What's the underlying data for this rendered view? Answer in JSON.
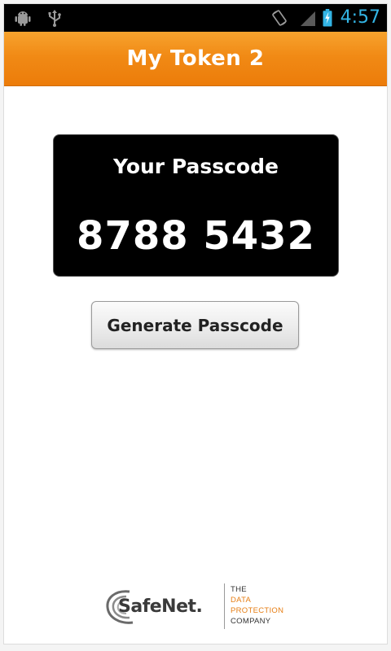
{
  "status_bar": {
    "time": "4:57",
    "icons": [
      "android-debug-icon",
      "usb-icon",
      "screen-rotation-icon",
      "signal-icon",
      "battery-charging-icon"
    ],
    "time_color": "#33b5e5"
  },
  "header": {
    "title": "My Token 2",
    "color": "#f18a15"
  },
  "passcode": {
    "label": "Your Passcode",
    "value": "8788 5432"
  },
  "actions": {
    "generate_label": "Generate Passcode"
  },
  "branding": {
    "logo_text": "SafeNet.",
    "tagline": [
      "THE",
      "DATA",
      "PROTECTION",
      "COMPANY"
    ],
    "accent_color": "#e67e14"
  }
}
